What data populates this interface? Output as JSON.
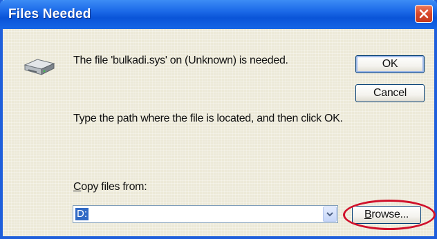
{
  "window": {
    "title": "Files Needed",
    "close_icon": "close-x-icon"
  },
  "dialog": {
    "icon": "disk-drive-icon",
    "message": "The file 'bulkadi.sys' on (Unknown) is needed.",
    "instruction": "Type the path where the file is located, and then click OK.",
    "copy_from_label_first": "C",
    "copy_from_label_rest": "opy files from:",
    "copy_from_value": "D:",
    "combo_arrow_icon": "chevron-down-icon"
  },
  "buttons": {
    "ok": "OK",
    "cancel": "Cancel",
    "browse_first": "B",
    "browse_rest": "rowse..."
  },
  "colors": {
    "titlebar": "#0a54d8",
    "dialog_bg": "#ece9d8",
    "selection": "#316ac5",
    "highlight_ring": "#d0112b",
    "close_button": "#d7472a"
  }
}
